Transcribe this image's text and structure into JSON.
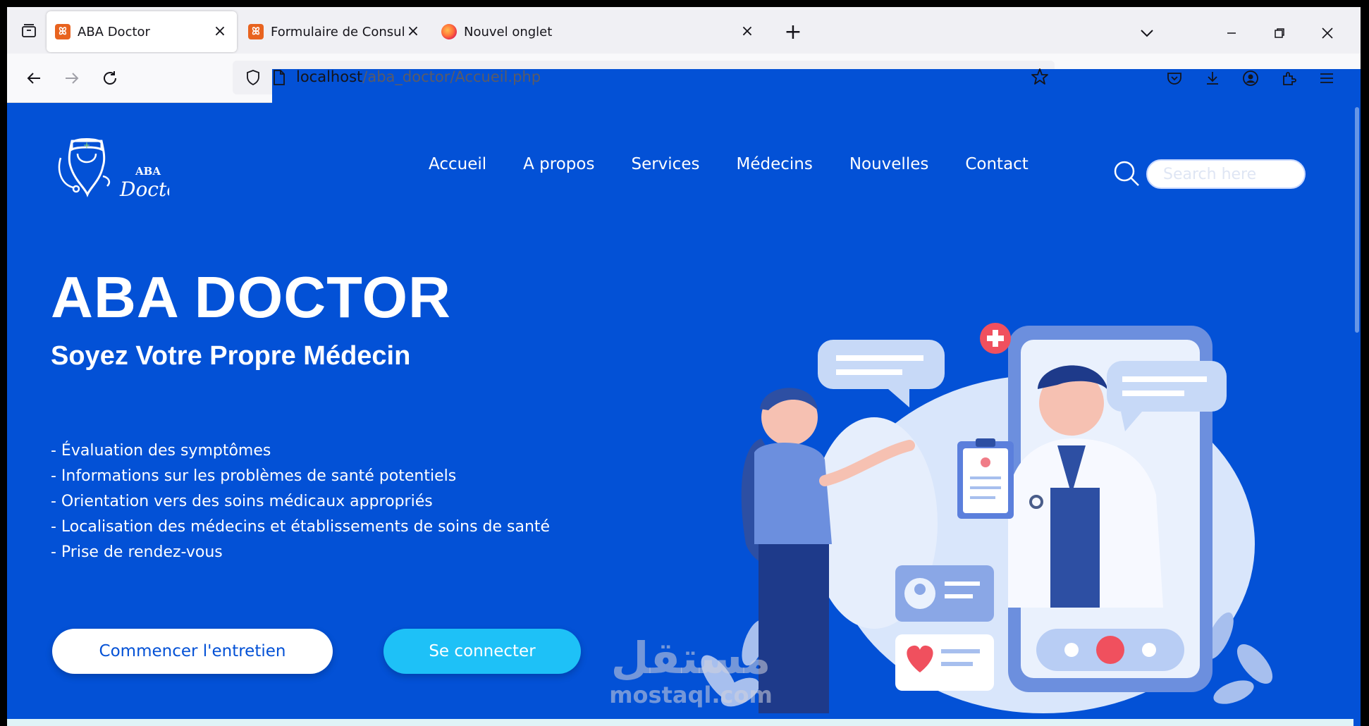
{
  "browser": {
    "tabs": [
      {
        "title": "ABA Doctor",
        "favicon": "xampp-icon",
        "active": true
      },
      {
        "title": "Formulaire de Consultation Mé",
        "favicon": "xampp-icon",
        "active": false
      },
      {
        "title": "Nouvel onglet",
        "favicon": "firefox-icon",
        "active": false
      }
    ],
    "url": {
      "host": "localhost",
      "path": "/aba_doctor/Accueil.php"
    }
  },
  "site": {
    "logo": {
      "line1": "ABA",
      "line2": "Doctor"
    },
    "nav": [
      "Accueil",
      "A propos",
      "Services",
      "Médecins",
      "Nouvelles",
      "Contact"
    ],
    "search_placeholder": "Search here",
    "hero": {
      "title": "ABA DOCTOR",
      "subtitle": "Soyez Votre Propre Médecin",
      "features": [
        "- Évaluation des symptômes",
        "- Informations sur les problèmes de santé potentiels",
        "- Orientation vers des soins médicaux appropriés",
        "- Localisation des médecins et établissements de soins de santé",
        "- Prise de rendez-vous"
      ],
      "btn_start": "Commencer l'entretien",
      "btn_login": "Se connecter"
    },
    "watermark": {
      "arabic": "مستقل",
      "latin": "mostaql.com"
    }
  },
  "colors": {
    "page_bg": "#0351d6",
    "login_btn": "#1ec1f7",
    "favicon": "#e8631f"
  }
}
